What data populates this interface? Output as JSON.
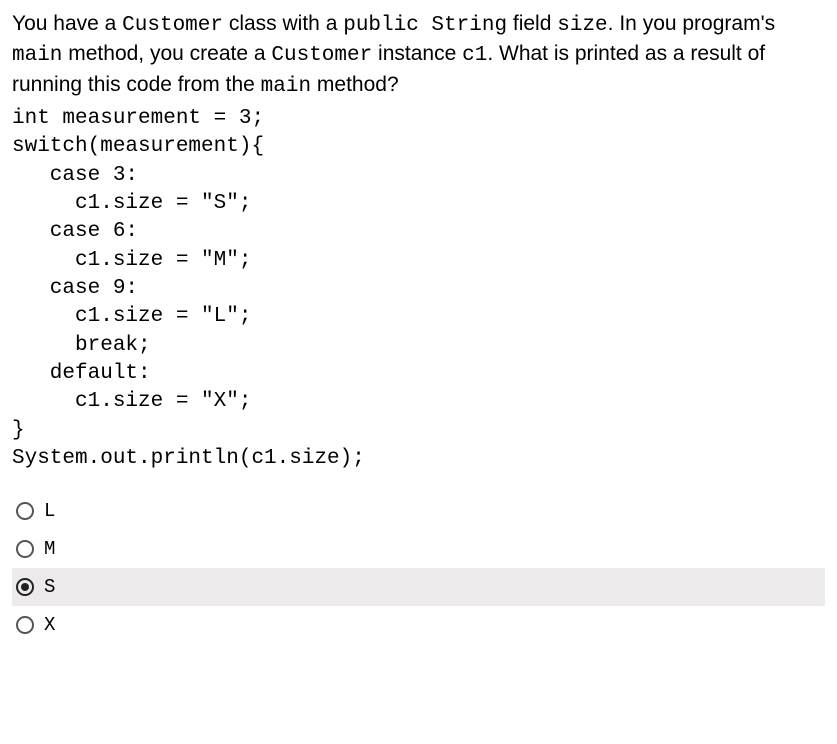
{
  "question": {
    "parts": [
      {
        "t": "You have a ",
        "mono": false
      },
      {
        "t": "Customer",
        "mono": true
      },
      {
        "t": " class with a ",
        "mono": false
      },
      {
        "t": "public String",
        "mono": true
      },
      {
        "t": " field ",
        "mono": false
      },
      {
        "t": "size",
        "mono": true
      },
      {
        "t": ". In you program's ",
        "mono": false
      },
      {
        "t": "main",
        "mono": true
      },
      {
        "t": " method, you create a ",
        "mono": false
      },
      {
        "t": "Customer",
        "mono": true
      },
      {
        "t": " instance ",
        "mono": false
      },
      {
        "t": "c1",
        "mono": true
      },
      {
        "t": ". What is printed as a result of running this code from the ",
        "mono": false
      },
      {
        "t": "main",
        "mono": true
      },
      {
        "t": " method?",
        "mono": false
      }
    ]
  },
  "code": "int measurement = 3;\nswitch(measurement){\n   case 3:\n     c1.size = \"S\";\n   case 6:\n     c1.size = \"M\";\n   case 9:\n     c1.size = \"L\";\n     break;\n   default:\n     c1.size = \"X\";\n}\nSystem.out.println(c1.size);",
  "options": [
    {
      "label": "L",
      "selected": false
    },
    {
      "label": "M",
      "selected": false
    },
    {
      "label": "S",
      "selected": true
    },
    {
      "label": "X",
      "selected": false
    }
  ]
}
